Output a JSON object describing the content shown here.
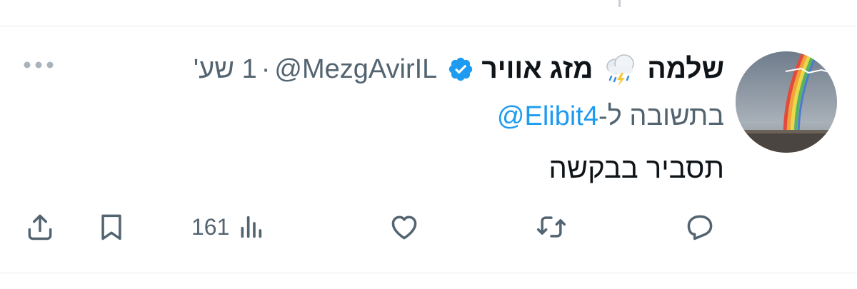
{
  "tweet": {
    "display_name": "שלמה",
    "name_suffix": "מזג אוויר",
    "handle": "@MezgAvirIL",
    "separator": "·",
    "time": "1 שע'",
    "reply_prefix": "בתשובה ל-",
    "reply_to": "@Elibit4",
    "text": "תסביר בבקשה",
    "views_count": "161"
  },
  "icons": {
    "name_emoji": "cloud-rain-lightning-icon",
    "verified": "verified-badge-icon",
    "more": "more-icon",
    "reply": "reply-icon",
    "retweet": "retweet-icon",
    "like": "like-icon",
    "views": "views-icon",
    "bookmark": "bookmark-icon",
    "share": "share-icon"
  },
  "colors": {
    "link": "#1d9bf0",
    "secondary_text": "#536471",
    "text": "#0f1419"
  }
}
